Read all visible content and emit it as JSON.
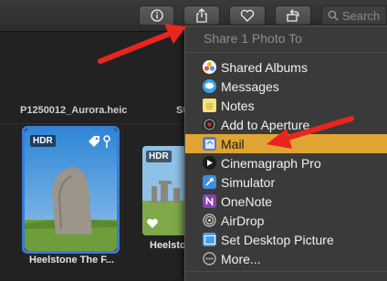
{
  "toolbar": {
    "buttons": [
      {
        "name": "info-icon"
      },
      {
        "name": "share-icon"
      },
      {
        "name": "heart-icon"
      },
      {
        "name": "rotate-icon"
      }
    ],
    "search_placeholder": "Search"
  },
  "grid": {
    "filename_left": "P1250012_Aurora.heic",
    "filename_right_partial": "St",
    "photo1": {
      "badge": "HDR",
      "caption": "Heelstone The F..."
    },
    "photo2": {
      "badge": "HDR",
      "caption": "Heelsto"
    }
  },
  "share_menu": {
    "title": "Share 1 Photo To",
    "items": [
      {
        "label": "Shared Albums",
        "icon": "shared-albums-icon",
        "color": "#e94f3c"
      },
      {
        "label": "Messages",
        "icon": "messages-icon",
        "color": "#3aa4f0"
      },
      {
        "label": "Notes",
        "icon": "notes-icon",
        "color": "#f5e27a"
      },
      {
        "label": "Add to Aperture",
        "icon": "aperture-icon",
        "color": "#555555"
      },
      {
        "label": "Mail",
        "icon": "mail-icon",
        "color": "#4a7fd0"
      },
      {
        "label": "Cinemagraph Pro",
        "icon": "cinemagraph-icon",
        "color": "#2b2b2b"
      },
      {
        "label": "Simulator",
        "icon": "simulator-icon",
        "color": "#3c8fe0"
      },
      {
        "label": "OneNote",
        "icon": "onenote-icon",
        "color": "#8b3fb5"
      },
      {
        "label": "AirDrop",
        "icon": "airdrop-icon",
        "color": "#9a9a9a"
      },
      {
        "label": "Set Desktop Picture",
        "icon": "desktop-picture-icon",
        "color": "#4aa0e8"
      },
      {
        "label": "More...",
        "icon": "more-icon",
        "color": "#777777"
      }
    ],
    "highlighted": "Mail"
  },
  "annotation_color": "#e8261e"
}
